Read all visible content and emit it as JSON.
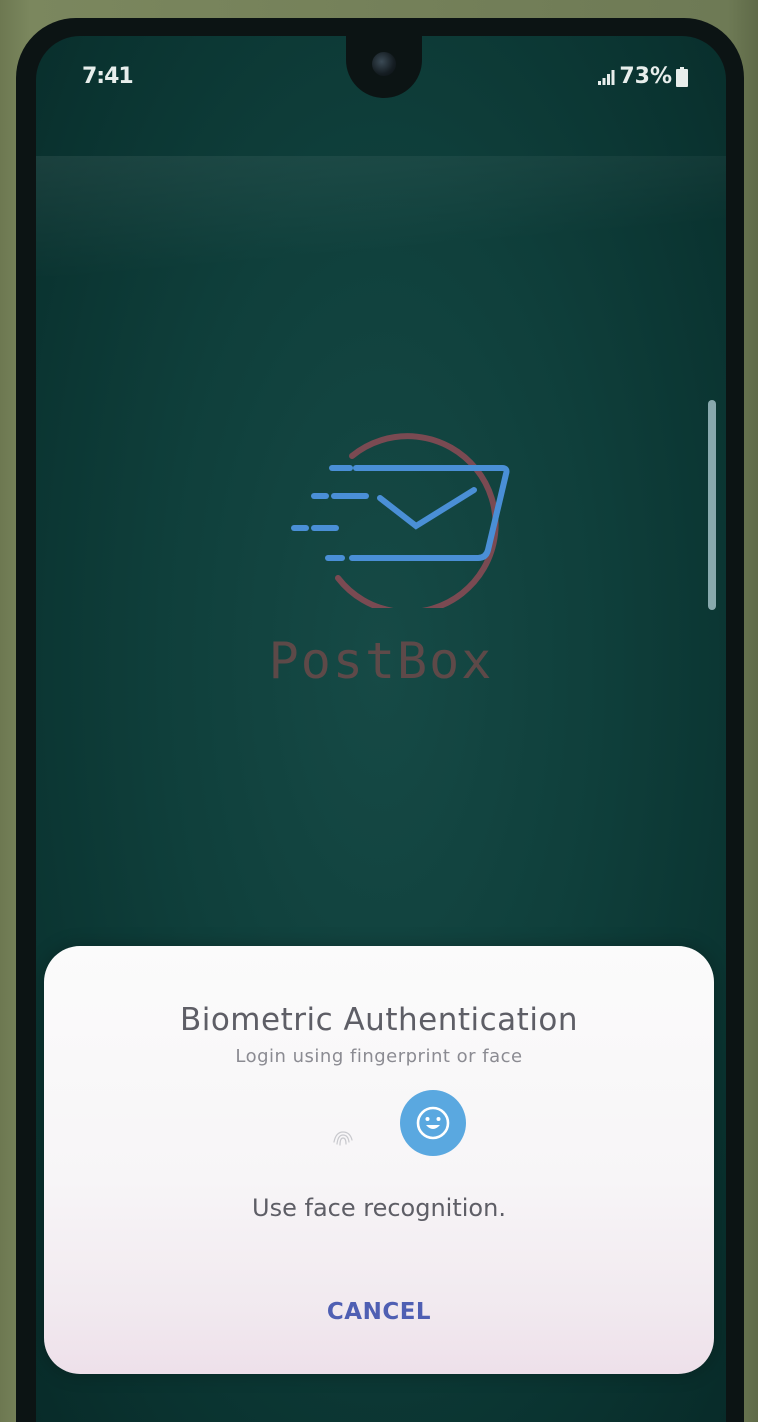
{
  "status_bar": {
    "time": "7:41",
    "battery": "73%",
    "icons": [
      "signal-icon",
      "battery-icon"
    ]
  },
  "app": {
    "brand_name": "PostBox",
    "logo_icon": "envelope-logo-icon"
  },
  "dialog": {
    "title": "Biometric Authentication",
    "subtitle": "Login using fingerprint or face",
    "prompt": "Use face recognition.",
    "cancel_label": "CANCEL",
    "icons": [
      "fingerprint-icon",
      "face-recognition-icon"
    ]
  },
  "colors": {
    "screen_background": "#0f3f3b",
    "logo_blue": "#4a8fd6",
    "logo_ring": "#7a4a52",
    "face_button": "#5aa8e0",
    "cancel_text": "#4f5fb3"
  }
}
